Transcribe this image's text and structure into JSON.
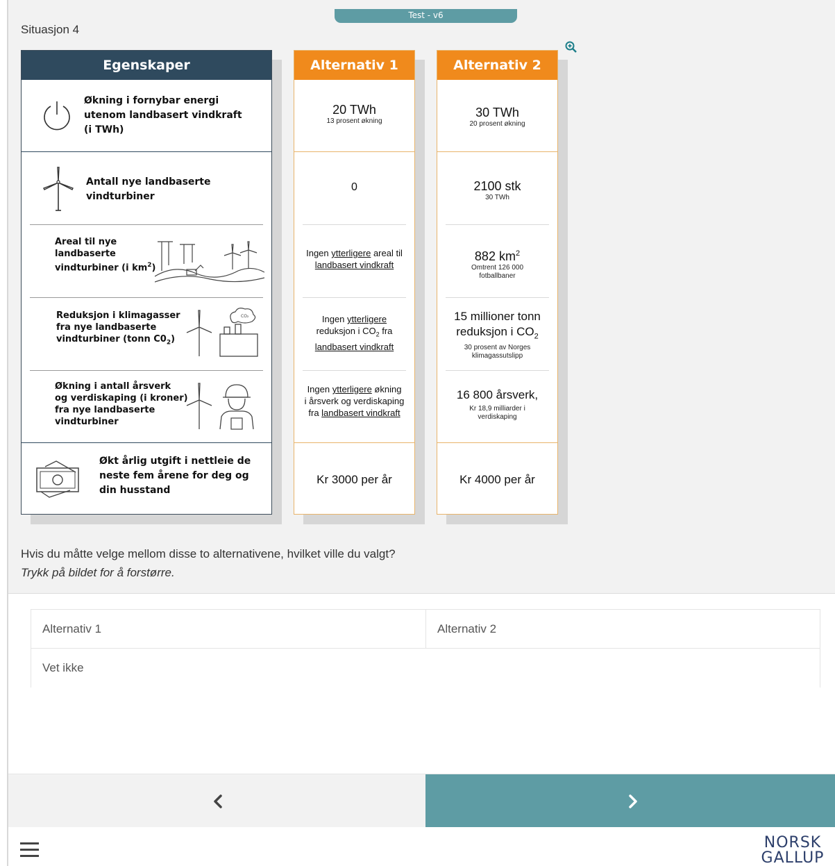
{
  "header": {
    "version_tab": "Test - v6",
    "situation": "Situasjon 4"
  },
  "table": {
    "attr_header": "Egenskaper",
    "alt1_header": "Alternativ 1",
    "alt2_header": "Alternativ 2",
    "rows": [
      {
        "attribute": "Økning i fornybar energi utenom landbasert vindkraft (i TWh)",
        "alt1_main": "20 TWh",
        "alt1_sub": "13 prosent økning",
        "alt2_main": "30 TWh",
        "alt2_sub": "20 prosent økning"
      },
      {
        "attribute": "Antall nye landbaserte vindturbiner",
        "alt1_main": "0",
        "alt2_main": "2100 stk",
        "alt2_sub": "30 TWh"
      },
      {
        "attribute_line1": "Areal til nye",
        "attribute_line2": "landbaserte",
        "attribute_line3": "vindturbiner (i km",
        "attribute_sup": "2",
        "attribute_end": ")",
        "alt1_pre": "Ingen ",
        "alt1_u1": "ytterligere",
        "alt1_mid": " areal til",
        "alt1_u2": "landbasert vindkraft",
        "alt2_main": "882 km",
        "alt2_sup": "2",
        "alt2_sub1": "Omtrent 126 000",
        "alt2_sub2": "fotballbaner"
      },
      {
        "attribute_line1": "Reduksjon i klimagasser",
        "attribute_line2": "fra nye landbaserte",
        "attribute_line3": "vindturbiner (tonn C0",
        "attribute_sub": "2",
        "attribute_end": ")",
        "alt1_pre": "Ingen ",
        "alt1_u1": "ytterligere",
        "alt1_line2": "reduksjon i CO",
        "alt1_co2_sub": "2",
        "alt1_line2_end": " fra",
        "alt1_u2": "landbasert vindkraft",
        "alt2_main1": "15 millioner tonn",
        "alt2_main2": "reduksjon i CO",
        "alt2_co2_sub": "2",
        "alt2_sub1": "30 prosent av Norges",
        "alt2_sub2": "klimagassutslipp"
      },
      {
        "attribute_line1": "Økning i antall årsverk",
        "attribute_line2": "og verdiskaping (i kroner)",
        "attribute_line3": "fra nye landbaserte",
        "attribute_line4": "vindturbiner",
        "alt1_pre": "Ingen ",
        "alt1_u1": "ytterligere",
        "alt1_mid": " økning",
        "alt1_line2": "i årsverk og verdiskaping",
        "alt1_line3_pre": "fra ",
        "alt1_u2": "landbasert vindkraft",
        "alt2_main": "16 800 årsverk,",
        "alt2_sub1": "Kr 18,9 milliarder i",
        "alt2_sub2": "verdiskaping"
      },
      {
        "attribute": "Økt årlig utgift i nettleie de neste fem årene for deg og din husstand",
        "alt1_main": "Kr 3000 per år",
        "alt2_main": "Kr 4000 per år"
      }
    ]
  },
  "question": {
    "text": "Hvis du måtte velge mellom disse to alternativene, hvilket ville du valgt?",
    "hint": "Trykk på bildet for å forstørre."
  },
  "options": [
    "Alternativ 1",
    "Alternativ 2",
    "Vet ikke"
  ],
  "footer": {
    "logo_line1": "NORSK",
    "logo_line2": "GALLUP"
  },
  "colors": {
    "teal": "#5e9ca4",
    "navy": "#2f4a5e",
    "orange": "#f08a1c"
  }
}
